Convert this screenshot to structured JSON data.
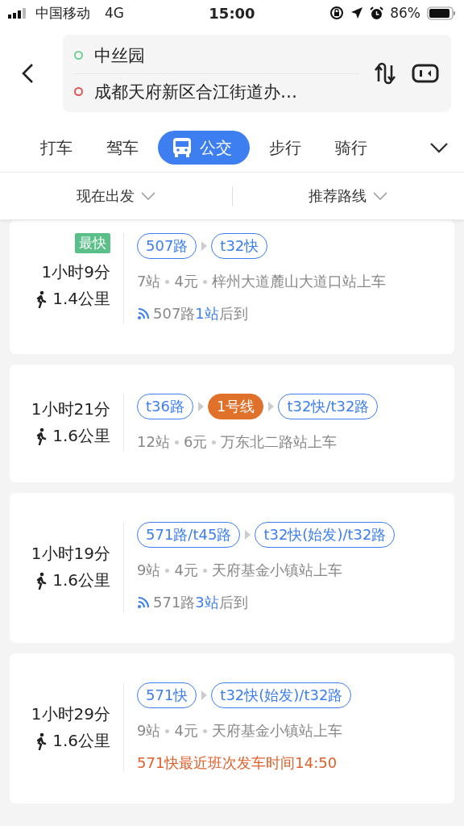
{
  "status_bar": {
    "carrier": "中国移动",
    "network": "4G",
    "time": "15:00",
    "battery": "86%"
  },
  "route_input": {
    "origin": "中丝园",
    "destination": "成都天府新区合江街道办…"
  },
  "tabs": [
    {
      "label": "打车",
      "selected": false
    },
    {
      "label": "驾车",
      "selected": false
    },
    {
      "label": "公交",
      "selected": true
    },
    {
      "label": "步行",
      "selected": false
    },
    {
      "label": "骑行",
      "selected": false
    }
  ],
  "filters": [
    {
      "label": "现在出发"
    },
    {
      "label": "推荐路线"
    }
  ],
  "routes": [
    {
      "badge": "最快",
      "duration": "1小时9分",
      "walk": "1.4公里",
      "lines": [
        {
          "name": "507路",
          "kind": "bus"
        },
        {
          "name": "t32快",
          "kind": "bus"
        }
      ],
      "stops": "7站",
      "fare": "4元",
      "board": "梓州大道麓山大道口站上车",
      "realtime": {
        "route": "507路",
        "eta": "1站",
        "suffix": "后到"
      }
    },
    {
      "duration": "1小时21分",
      "walk": "1.6公里",
      "lines": [
        {
          "name": "t36路",
          "kind": "bus"
        },
        {
          "name": "1号线",
          "kind": "metro"
        },
        {
          "name": "t32快/t32路",
          "kind": "bus"
        }
      ],
      "stops": "12站",
      "fare": "6元",
      "board": "万东北二路站上车"
    },
    {
      "duration": "1小时19分",
      "walk": "1.6公里",
      "lines": [
        {
          "name": "571路/t45路",
          "kind": "bus"
        },
        {
          "name": "t32快(始发)/t32路",
          "kind": "bus"
        }
      ],
      "stops": "9站",
      "fare": "4元",
      "board": "天府基金小镇站上车",
      "realtime": {
        "route": "571路",
        "eta": "3站",
        "suffix": "后到"
      }
    },
    {
      "duration": "1小时29分",
      "walk": "1.6公里",
      "lines": [
        {
          "name": "571快",
          "kind": "bus"
        },
        {
          "name": "t32快(始发)/t32路",
          "kind": "bus"
        }
      ],
      "stops": "9站",
      "fare": "4元",
      "board": "天府基金小镇站上车",
      "notice": "571快最近班次发车时间14:50"
    }
  ]
}
